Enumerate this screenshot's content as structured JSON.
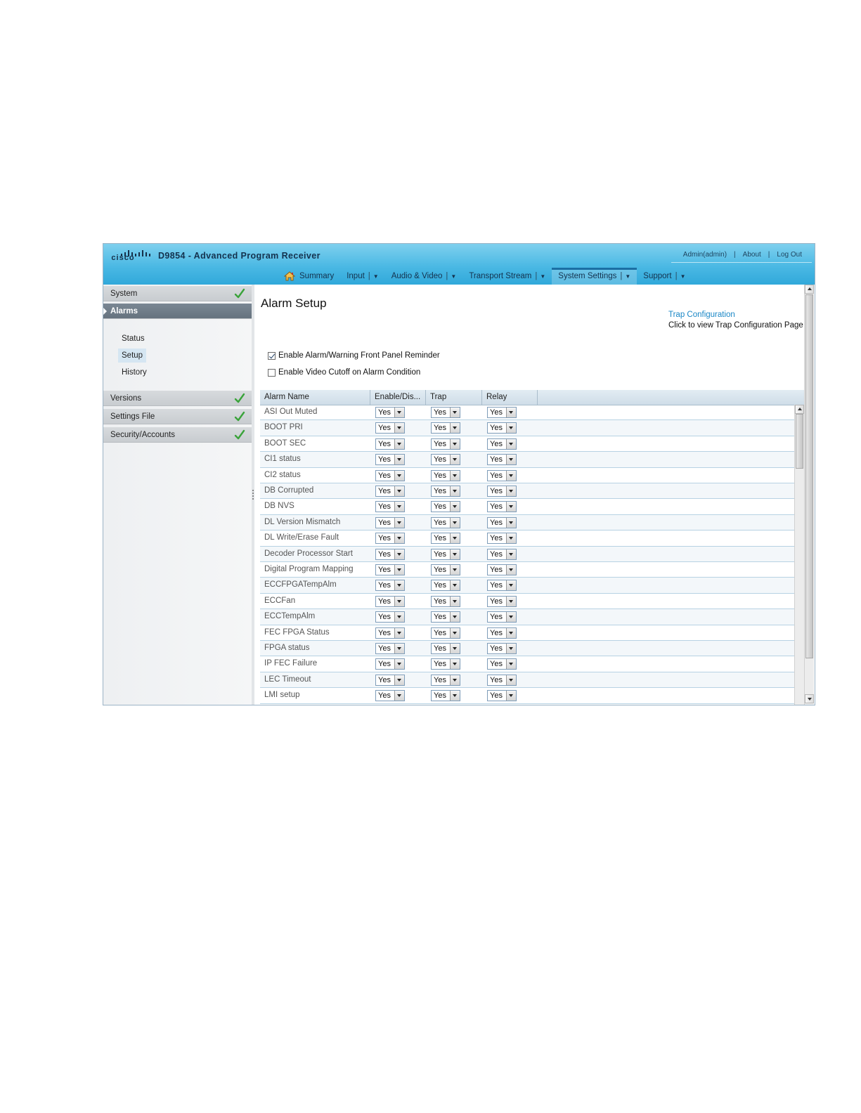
{
  "header": {
    "brand": "cisco",
    "title": "D9854 - Advanced Program Receiver",
    "user": "Admin(admin)",
    "about": "About",
    "logout": "Log Out"
  },
  "nav": {
    "summary": "Summary",
    "input": "Input",
    "audio_video": "Audio & Video",
    "transport_stream": "Transport Stream",
    "system_settings": "System Settings",
    "support": "Support",
    "active": "System Settings"
  },
  "sidebar": {
    "system": "System",
    "alarms": "Alarms",
    "alarm_status": "Status",
    "alarm_setup": "Setup",
    "alarm_history": "History",
    "versions": "Versions",
    "settings_file": "Settings File",
    "security_accounts": "Security/Accounts"
  },
  "main": {
    "title": "Alarm Setup",
    "trap_link": "Trap Configuration",
    "trap_desc": "Click to view Trap Configuration Page",
    "front_panel_label": "Enable Alarm/Warning Front Panel Reminder",
    "front_panel_checked": true,
    "video_cutoff_label": "Enable Video Cutoff on Alarm Condition",
    "video_cutoff_checked": false
  },
  "table": {
    "columns": [
      "Alarm Name",
      "Enable/Dis...",
      "Trap",
      "Relay"
    ],
    "rows": [
      {
        "name": "ASI Out Muted",
        "enable": "Yes",
        "trap": "Yes",
        "relay": "Yes"
      },
      {
        "name": "BOOT PRI",
        "enable": "Yes",
        "trap": "Yes",
        "relay": "Yes"
      },
      {
        "name": "BOOT SEC",
        "enable": "Yes",
        "trap": "Yes",
        "relay": "Yes"
      },
      {
        "name": "CI1 status",
        "enable": "Yes",
        "trap": "Yes",
        "relay": "Yes"
      },
      {
        "name": "CI2 status",
        "enable": "Yes",
        "trap": "Yes",
        "relay": "Yes"
      },
      {
        "name": "DB Corrupted",
        "enable": "Yes",
        "trap": "Yes",
        "relay": "Yes"
      },
      {
        "name": "DB NVS",
        "enable": "Yes",
        "trap": "Yes",
        "relay": "Yes"
      },
      {
        "name": "DL Version Mismatch",
        "enable": "Yes",
        "trap": "Yes",
        "relay": "Yes"
      },
      {
        "name": "DL Write/Erase Fault",
        "enable": "Yes",
        "trap": "Yes",
        "relay": "Yes"
      },
      {
        "name": "Decoder Processor Start",
        "enable": "Yes",
        "trap": "Yes",
        "relay": "Yes"
      },
      {
        "name": "Digital Program Mapping",
        "enable": "Yes",
        "trap": "Yes",
        "relay": "Yes"
      },
      {
        "name": "ECCFPGATempAlm",
        "enable": "Yes",
        "trap": "Yes",
        "relay": "Yes"
      },
      {
        "name": "ECCFan",
        "enable": "Yes",
        "trap": "Yes",
        "relay": "Yes"
      },
      {
        "name": "ECCTempAlm",
        "enable": "Yes",
        "trap": "Yes",
        "relay": "Yes"
      },
      {
        "name": "FEC FPGA Status",
        "enable": "Yes",
        "trap": "Yes",
        "relay": "Yes"
      },
      {
        "name": "FPGA status",
        "enable": "Yes",
        "trap": "Yes",
        "relay": "Yes"
      },
      {
        "name": "IP FEC Failure",
        "enable": "Yes",
        "trap": "Yes",
        "relay": "Yes"
      },
      {
        "name": "LEC Timeout",
        "enable": "Yes",
        "trap": "Yes",
        "relay": "Yes"
      },
      {
        "name": "LMI setup",
        "enable": "Yes",
        "trap": "Yes",
        "relay": "Yes"
      }
    ]
  },
  "icons": {
    "home": "home-icon",
    "check": "check-icon",
    "dropdown": "chevron-down-icon"
  },
  "colors": {
    "header_blue": "#4bb9e4",
    "link_blue": "#1a87c6",
    "active_section": "#6f7c88",
    "check_green": "#3aa33a"
  }
}
